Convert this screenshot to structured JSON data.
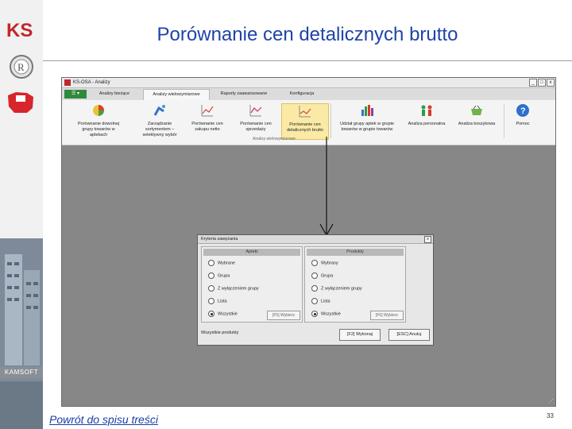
{
  "slide": {
    "title": "Porównanie cen detalicznych brutto",
    "footer_link": "Powrót do spisu treści",
    "page_number": "33",
    "brand_band": "KAMSOFT"
  },
  "app": {
    "window_title": "KS-OSA - Analizy",
    "menu_button": "☰ ▾",
    "window_buttons": [
      "_",
      "□",
      "x"
    ],
    "tabs": [
      "Analizy bieżące",
      "Analizy wielowymiarowe",
      "Raporty zaawansowane",
      "Konfiguracja"
    ],
    "active_tab": "Analizy wielowymiarowe",
    "ribbon_buttons": [
      {
        "label": "Porównanie dowolnej grupy towarów w aptekach",
        "icon": "pie-chart-icon"
      },
      {
        "label": "Zarządzanie sortymentem – selektywny wybór",
        "icon": "scatter-chart-icon"
      },
      {
        "label": "Porównanie cen zakupu netto",
        "icon": "line-chart-icon"
      },
      {
        "label": "Porównanie cen sprzedaży",
        "icon": "line-chart-icon"
      },
      {
        "label": "Porównanie cen detalicznych brutto",
        "icon": "line-chart-icon"
      },
      {
        "label": "Udział grupy aptek w grupie towarów w grupie towarów",
        "icon": "bar-chart-icon"
      },
      {
        "label": "Analiza personalna",
        "icon": "people-icon"
      },
      {
        "label": "Analiza koszykowa",
        "icon": "basket-icon"
      },
      {
        "label": "Pomoc",
        "icon": "help-icon"
      }
    ],
    "ribbon_group_caption": "Analizy wielowymiarowe"
  },
  "dialog": {
    "title": "Kryteria zawężania",
    "close": "x",
    "panels": [
      {
        "header": "Apteki",
        "options": [
          "Wybrane",
          "Grupa",
          "Z wyłączeniem grupy",
          "Lista",
          "Wszystkie"
        ],
        "selected_index": 4,
        "button": "[F5] Wybierz"
      },
      {
        "header": "Produkty",
        "options": [
          "Wybrany",
          "Grupa",
          "Z wyłączeniem grupy",
          "Lista",
          "Wszystkie"
        ],
        "selected_index": 4,
        "button": "[F6] Wybierz"
      }
    ],
    "status": "Wszystkie produkty",
    "ok_button": "[F2] Wykonaj",
    "cancel_button": "[ESC] Anuluj"
  },
  "colors": {
    "title_blue": "#1f43a8",
    "ks_red": "#c0282d",
    "highlight": "#fbeaa5"
  }
}
